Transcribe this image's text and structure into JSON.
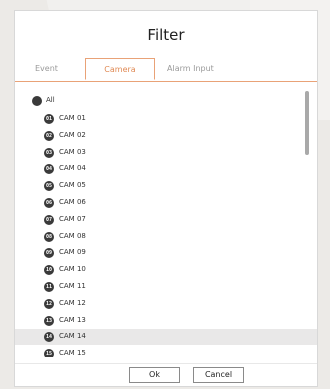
{
  "dialog": {
    "title": "Filter",
    "tabs": [
      {
        "label": "Event",
        "active": false
      },
      {
        "label": "Camera",
        "active": true
      },
      {
        "label": "Alarm Input",
        "active": false
      }
    ],
    "all_label": "All",
    "cameras": [
      {
        "badge": "01",
        "label": "CAM 01"
      },
      {
        "badge": "02",
        "label": "CAM 02"
      },
      {
        "badge": "03",
        "label": "CAM 03"
      },
      {
        "badge": "04",
        "label": "CAM 04"
      },
      {
        "badge": "05",
        "label": "CAM 05"
      },
      {
        "badge": "06",
        "label": "CAM 06"
      },
      {
        "badge": "07",
        "label": "CAM 07"
      },
      {
        "badge": "08",
        "label": "CAM 08"
      },
      {
        "badge": "09",
        "label": "CAM 09"
      },
      {
        "badge": "10",
        "label": "CAM 10"
      },
      {
        "badge": "11",
        "label": "CAM 11"
      },
      {
        "badge": "12",
        "label": "CAM 12"
      },
      {
        "badge": "13",
        "label": "CAM 13"
      },
      {
        "badge": "14",
        "label": "CAM 14"
      },
      {
        "badge": "15",
        "label": "CAM 15"
      }
    ],
    "ok_label": "Ok",
    "cancel_label": "Cancel"
  },
  "colors": {
    "accent": "#e08a55",
    "icon": "#3a3a3a",
    "highlight_row": "#e9e8e8"
  },
  "icons": {
    "all": "filled-circle-icon",
    "camera": "camera-number-badge-icon"
  }
}
